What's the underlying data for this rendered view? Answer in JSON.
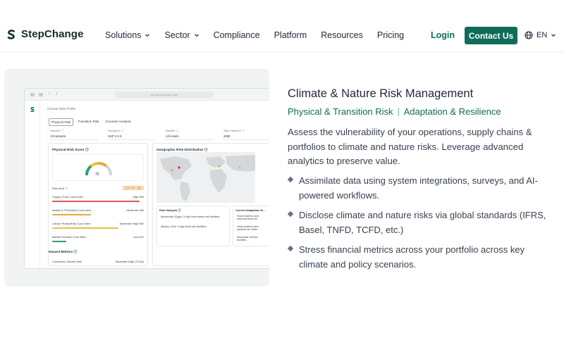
{
  "nav": {
    "brand": "StepChange",
    "items": [
      {
        "label": "Solutions",
        "dropdown": true
      },
      {
        "label": "Sector",
        "dropdown": true
      },
      {
        "label": "Compliance",
        "dropdown": false
      },
      {
        "label": "Platform",
        "dropdown": false
      },
      {
        "label": "Resources",
        "dropdown": false
      },
      {
        "label": "Pricing",
        "dropdown": false
      }
    ],
    "login": "Login",
    "contact": "Contact Us",
    "language": "EN"
  },
  "colors": {
    "brand": "#0f6b5a",
    "text": "#374151",
    "bullet": "#6b6f8a"
  },
  "preview": {
    "url": "app.stepchange.earth",
    "breadcrumb": "Climate Risk Profile",
    "tabs": [
      "Physical Risk",
      "Transition Risk",
      "Scenario Analysis"
    ],
    "filters": [
      {
        "label": "Hazard* ⓘ",
        "value": "All Hazards"
      },
      {
        "label": "Scenario* ⓘ",
        "value": "SSP 2-4.5"
      },
      {
        "label": "Assets* ⓘ",
        "value": "All Assets"
      },
      {
        "label": "Time Horizon* ⓘ",
        "value": "2050"
      }
    ],
    "score_card": {
      "title": "Physical Risk Score ⓘ",
      "score": "72",
      "risk_level_label": "Risk level ⓘ",
      "risk_level_badge": "Moderate-High",
      "rows": [
        {
          "label": "Supply Chain Cost index",
          "value": "High £60",
          "fill": 0.95,
          "color": "#d95c4c"
        },
        {
          "label": "Assets & Processes Cost index",
          "value": "Moderate £80",
          "fill": 0.42,
          "color": "#e7a93b"
        },
        {
          "label": "Labour Productivity Cost Index",
          "value": "Moderate-High £60",
          "fill": 0.72,
          "color": "#e7c23b"
        },
        {
          "label": "Market Demand Cost index",
          "value": "Low £10",
          "fill": 0.15,
          "color": "#2f9e6e"
        }
      ],
      "metrics_title": "Hazard Metrics ⓘ",
      "metrics_row_label": "Combined Climate Risk",
      "metrics_row_value": "Moderate-High (73.48)"
    },
    "geo_card": {
      "title": "Geographic Risk Distribution ⓘ",
      "hotspots_title": "Risk Hotspots ⓘ",
      "hotspots": [
        "Alexandria, Egypt: 3 high heat stress risk facilities",
        "Albany, USA: 3 high flood risk facilities"
      ],
      "adaptation_title": "Current Adaptation M...",
      "adaptation": [
        "Flood barriers and improvements for",
        "Heat resilient infra systems for Delhi",
        "Structural reinforc facilities"
      ]
    }
  },
  "content": {
    "heading": "Climate & Nature Risk Management",
    "sub_left": "Physical & Transition Risk",
    "sub_right": "Adaptation & Resilience",
    "description": "Assess the vulnerability of your operations, supply chains & portfolios to climate and nature risks. Leverage advanced analytics to preserve value.",
    "bullets": [
      "Assimilate data using system integrations, surveys, and AI-powered workflows.",
      "Disclose climate and nature risks via global standards (IFRS, Basel, TNFD, TCFD, etc.)",
      "Stress financial metrics across your portfolio across key climate and policy scenarios."
    ]
  }
}
